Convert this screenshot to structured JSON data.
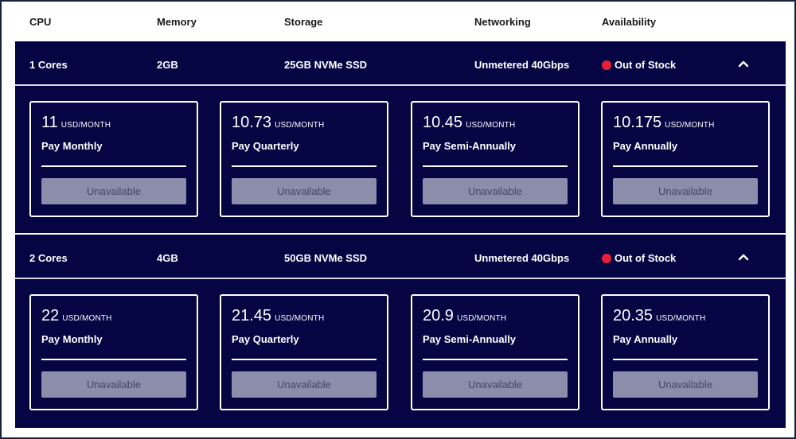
{
  "header": {
    "cpu": "CPU",
    "memory": "Memory",
    "storage": "Storage",
    "networking": "Networking",
    "availability": "Availability"
  },
  "plans": [
    {
      "cpu": "1 Cores",
      "memory": "2GB",
      "storage": "25GB NVMe SSD",
      "networking": "Unmetered 40Gbps",
      "availability": "Out of Stock",
      "status_color": "#e8203a",
      "options": [
        {
          "price": "11",
          "unit": "USD/MONTH",
          "term": "Pay Monthly",
          "button": "Unavailable"
        },
        {
          "price": "10.73",
          "unit": "USD/MONTH",
          "term": "Pay Quarterly",
          "button": "Unavailable"
        },
        {
          "price": "10.45",
          "unit": "USD/MONTH",
          "term": "Pay Semi-Annually",
          "button": "Unavailable"
        },
        {
          "price": "10.175",
          "unit": "USD/MONTH",
          "term": "Pay Annually",
          "button": "Unavailable"
        }
      ]
    },
    {
      "cpu": "2 Cores",
      "memory": "4GB",
      "storage": "50GB NVMe SSD",
      "networking": "Unmetered 40Gbps",
      "availability": "Out of Stock",
      "status_color": "#e8203a",
      "options": [
        {
          "price": "22",
          "unit": "USD/MONTH",
          "term": "Pay Monthly",
          "button": "Unavailable"
        },
        {
          "price": "21.45",
          "unit": "USD/MONTH",
          "term": "Pay Quarterly",
          "button": "Unavailable"
        },
        {
          "price": "20.9",
          "unit": "USD/MONTH",
          "term": "Pay Semi-Annually",
          "button": "Unavailable"
        },
        {
          "price": "20.35",
          "unit": "USD/MONTH",
          "term": "Pay Annually",
          "button": "Unavailable"
        }
      ]
    }
  ],
  "colors": {
    "panel": "#050544",
    "button": "#8c8cab",
    "button_text": "#444466",
    "status": "#e8203a"
  },
  "icons": {
    "collapse": "chevron-up-icon",
    "status": "status-dot-icon"
  }
}
